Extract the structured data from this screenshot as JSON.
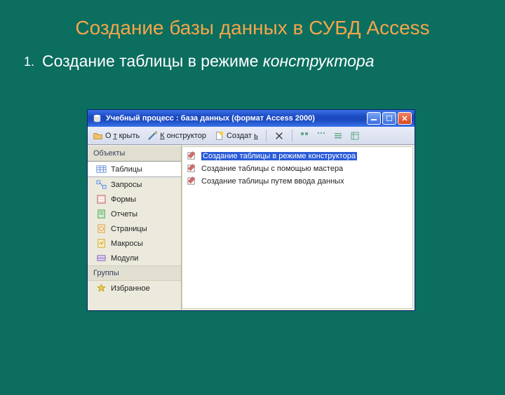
{
  "slide": {
    "title": "Создание базы данных в СУБД Access",
    "list_num": "1.",
    "subtitle_a": "Создание таблицы в режиме ",
    "subtitle_b": "конструктора"
  },
  "window": {
    "title": "Учебный процесс : база данных (формат Access 2000)"
  },
  "toolbar": {
    "open_pre": "О",
    "open_u": "т",
    "open_post": "крыть",
    "design_u": "К",
    "design_post": "онструктор",
    "create_pre": "Создат",
    "create_u": "ь"
  },
  "sidebar": {
    "header_objects": "Объекты",
    "items": [
      {
        "label": "Таблицы"
      },
      {
        "label": "Запросы"
      },
      {
        "label": "Формы"
      },
      {
        "label": "Отчеты"
      },
      {
        "label": "Страницы"
      },
      {
        "label": "Макросы"
      },
      {
        "label": "Модули"
      }
    ],
    "header_groups": "Группы",
    "fav": "Избранное"
  },
  "content": {
    "items": [
      {
        "label": "Создание таблицы в режиме конструктора"
      },
      {
        "label": "Создание таблицы с помощью мастера"
      },
      {
        "label": "Создание таблицы путем ввода данных"
      }
    ]
  }
}
